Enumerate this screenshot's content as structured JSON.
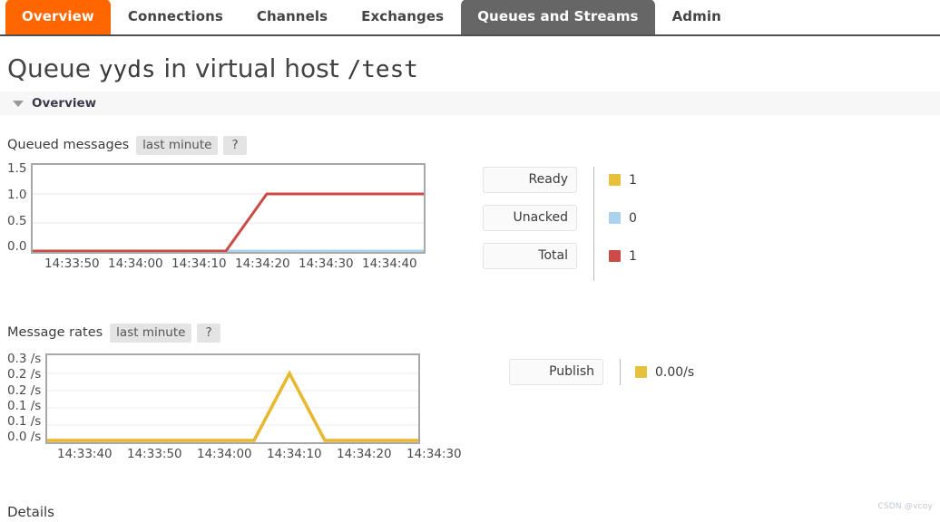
{
  "nav": {
    "tabs": [
      {
        "label": "Overview",
        "state": "active-orange"
      },
      {
        "label": "Connections",
        "state": "normal"
      },
      {
        "label": "Channels",
        "state": "normal"
      },
      {
        "label": "Exchanges",
        "state": "normal"
      },
      {
        "label": "Queues and Streams",
        "state": "active-gray"
      },
      {
        "label": "Admin",
        "state": "normal"
      }
    ]
  },
  "page": {
    "title_prefix": "Queue",
    "queue_name": "yyds",
    "title_middle": "in virtual host",
    "vhost": "/test",
    "section_overview_label": "Overview",
    "details_label": "Details",
    "watermark": "CSDN @vcoy"
  },
  "queued_messages": {
    "title": "Queued messages",
    "period_label": "last minute",
    "help_label": "?",
    "legend": [
      {
        "name": "Ready",
        "value": "1",
        "color": "#e8c13c"
      },
      {
        "name": "Unacked",
        "value": "0",
        "color": "#abd3ee"
      },
      {
        "name": "Total",
        "value": "1",
        "color": "#cc4b47"
      }
    ]
  },
  "message_rates": {
    "title": "Message rates",
    "period_label": "last minute",
    "help_label": "?",
    "legend": [
      {
        "name": "Publish",
        "value": "0.00/s",
        "color": "#e8c13c"
      }
    ]
  },
  "chart_data": [
    {
      "id": "queued-messages",
      "type": "line",
      "title": "Queued messages",
      "xlabel": "",
      "ylabel": "",
      "ylim": [
        0,
        1.5
      ],
      "yticks": [
        0.0,
        0.5,
        1.0,
        1.5
      ],
      "ytick_labels": [
        "0.0",
        "0.5",
        "1.0",
        "1.5"
      ],
      "xticks": [
        "14:33:50",
        "14:34:00",
        "14:34:10",
        "14:34:20",
        "14:34:30",
        "14:34:40"
      ],
      "xlim": [
        "14:33:45",
        "14:34:45"
      ],
      "grid": true,
      "legend_position": "right",
      "series": [
        {
          "name": "Ready",
          "color": "#e8c13c",
          "x": [
            "14:33:45",
            "14:34:00",
            "14:34:10",
            "14:34:15",
            "14:34:18",
            "14:34:30",
            "14:34:45"
          ],
          "values": [
            0,
            0,
            0,
            0,
            1,
            1,
            1
          ]
        },
        {
          "name": "Unacked",
          "color": "#abd3ee",
          "x": [
            "14:33:45",
            "14:34:00",
            "14:34:10",
            "14:34:15",
            "14:34:18",
            "14:34:30",
            "14:34:45"
          ],
          "values": [
            0,
            0,
            0,
            0,
            0,
            0,
            0
          ]
        },
        {
          "name": "Total",
          "color": "#cc4b47",
          "x": [
            "14:33:45",
            "14:34:00",
            "14:34:10",
            "14:34:15",
            "14:34:18",
            "14:34:30",
            "14:34:45"
          ],
          "values": [
            0,
            0,
            0,
            0,
            1,
            1,
            1
          ]
        }
      ]
    },
    {
      "id": "message-rates",
      "type": "line",
      "title": "Message rates",
      "xlabel": "",
      "ylabel": "/s",
      "ylim": [
        0,
        0.3
      ],
      "yticks": [
        0.0,
        0.05,
        0.1,
        0.15,
        0.2,
        0.3
      ],
      "ytick_labels": [
        "0.3 /s",
        "0.2 /s",
        "0.2 /s",
        "0.1 /s",
        "0.1 /s",
        "0.0 /s"
      ],
      "xticks": [
        "14:33:40",
        "14:33:50",
        "14:34:00",
        "14:34:10",
        "14:34:20",
        "14:34:30"
      ],
      "xlim": [
        "14:33:35",
        "14:34:35"
      ],
      "grid": true,
      "legend_position": "right",
      "series": [
        {
          "name": "Publish",
          "color": "#e8b730",
          "x": [
            "14:33:35",
            "14:34:00",
            "14:34:08",
            "14:34:14",
            "14:34:20",
            "14:34:35"
          ],
          "values": [
            0,
            0,
            0,
            0.25,
            0,
            0
          ]
        }
      ]
    }
  ]
}
